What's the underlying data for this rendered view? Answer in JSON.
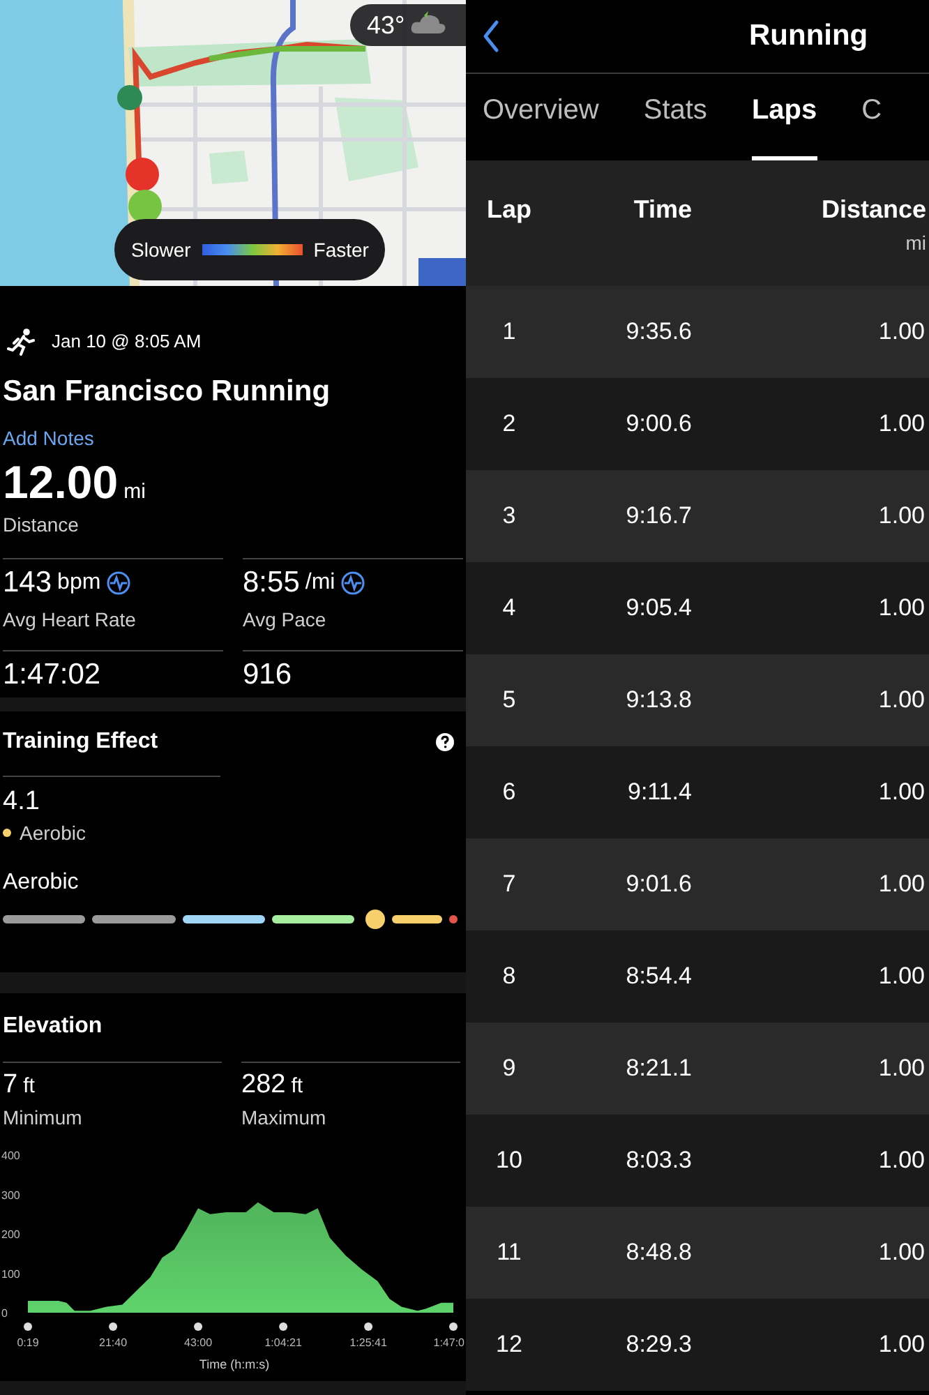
{
  "map": {
    "kind": "picture",
    "weather": {
      "temperature": "43°"
    },
    "legend": {
      "slow_label": "Slower",
      "fast_label": "Faster"
    }
  },
  "activity": {
    "date": "Jan 10 @ 8:05 AM",
    "title": "San Francisco Running",
    "notes_link": "Add Notes",
    "distance": {
      "value": "12.00",
      "unit": "mi",
      "label": "Distance"
    },
    "stats": [
      {
        "value": "143",
        "unit": "bpm",
        "label": "Avg Heart Rate",
        "chart_icon": true
      },
      {
        "value": "8:55",
        "unit": "/mi",
        "label": "Avg Pace",
        "chart_icon": true
      },
      {
        "value": "1:47:02",
        "chart_icon": false
      },
      {
        "value": "916",
        "chart_icon": false
      }
    ]
  },
  "training_effect": {
    "title": "Training Effect",
    "value": "4.1",
    "category": "Aerobic",
    "scale_title": "Aerobic",
    "level": 0.82,
    "segments": [
      {
        "color": "#9a9a9a"
      },
      {
        "color": "#9a9a9a"
      },
      {
        "color": "#9fd6f5"
      },
      {
        "color": "#a6eda0"
      },
      {
        "color": "#f7cf6b"
      },
      {
        "color": "#e5534b"
      }
    ]
  },
  "elevation": {
    "title": "Elevation",
    "stats": [
      {
        "value": "7",
        "unit": "ft",
        "label": "Minimum"
      },
      {
        "value": "282",
        "unit": "ft",
        "label": "Maximum"
      }
    ],
    "chart_data": {
      "type": "area",
      "xlabel": "Time (h:m:s)",
      "x": [
        19,
        480,
        600,
        720,
        960,
        1200,
        1440,
        1680,
        1860,
        2040,
        2220,
        2400,
        2580,
        2760,
        3000,
        3300,
        3480,
        3720,
        3960,
        4200,
        4380,
        4560,
        4800,
        5040,
        5280,
        5460,
        5640,
        5880,
        6000,
        6240,
        6420
      ],
      "series": [
        {
          "color": "#5fd36b",
          "values": [
            30,
            30,
            25,
            5,
            5,
            15,
            20,
            60,
            90,
            140,
            160,
            210,
            265,
            250,
            255,
            255,
            280,
            255,
            255,
            250,
            265,
            190,
            145,
            110,
            80,
            35,
            15,
            5,
            10,
            25,
            25
          ]
        }
      ],
      "ylim": [
        0,
        400
      ],
      "yticks": [
        0,
        100,
        200,
        300,
        400
      ],
      "xlim": [
        19,
        6420
      ],
      "xticks": [
        {
          "value": 19,
          "label": "0:19"
        },
        {
          "value": 1300,
          "label": "21:40"
        },
        {
          "value": 2580,
          "label": "43:00"
        },
        {
          "value": 3861,
          "label": "1:04:21"
        },
        {
          "value": 5141,
          "label": "1:25:41"
        },
        {
          "value": 6420,
          "label": "1:47:0"
        }
      ]
    }
  },
  "laps_screen": {
    "title": "Running",
    "tabs": [
      {
        "label": "Overview",
        "selected": false
      },
      {
        "label": "Stats",
        "selected": false
      },
      {
        "label": "Laps",
        "selected": true
      },
      {
        "label": "C",
        "selected": false
      }
    ],
    "table": {
      "columns": [
        {
          "label": "Lap"
        },
        {
          "label": "Time"
        },
        {
          "label": "Distance",
          "unit": "mi"
        }
      ],
      "rows": [
        [
          "1",
          "9:35.6",
          "1.00"
        ],
        [
          "2",
          "9:00.6",
          "1.00"
        ],
        [
          "3",
          "9:16.7",
          "1.00"
        ],
        [
          "4",
          "9:05.4",
          "1.00"
        ],
        [
          "5",
          "9:13.8",
          "1.00"
        ],
        [
          "6",
          "9:11.4",
          "1.00"
        ],
        [
          "7",
          "9:01.6",
          "1.00"
        ],
        [
          "8",
          "8:54.4",
          "1.00"
        ],
        [
          "9",
          "8:21.1",
          "1.00"
        ],
        [
          "10",
          "8:03.3",
          "1.00"
        ],
        [
          "11",
          "8:48.8",
          "1.00"
        ],
        [
          "12",
          "8:29.3",
          "1.00"
        ]
      ]
    }
  }
}
